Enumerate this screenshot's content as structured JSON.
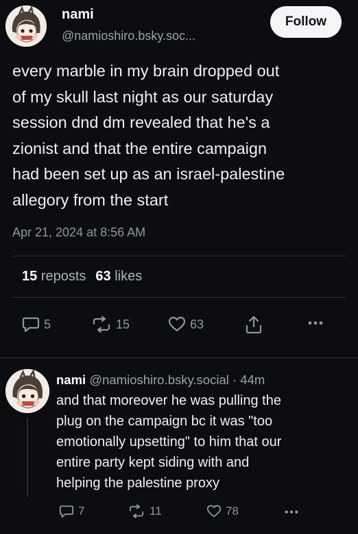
{
  "post": {
    "author": {
      "display_name": "nami",
      "handle": "@namioshiro.bsky.soc..."
    },
    "follow_label": "Follow",
    "text_lines": [
      "every marble in my brain dropped out",
      "of my skull last night as our saturday",
      "session dnd dm revealed that he's a",
      "zionist and that the entire campaign",
      "had been set up as an israel-palestine",
      "allegory from the start"
    ],
    "timestamp": "Apr 21, 2024 at 8:56 AM",
    "stats": {
      "reposts_count": "15",
      "reposts_label": "reposts",
      "likes_count": "63",
      "likes_label": "likes"
    },
    "actions": {
      "replies": "5",
      "reposts": "15",
      "likes": "63",
      "share_icon": "share-icon",
      "more_icon": "more-icon"
    }
  },
  "reply": {
    "display_name": "nami",
    "handle": "@namioshiro.bsky.social",
    "separator": "·",
    "age": "44m",
    "text_lines": [
      "and that moreover he was pulling the",
      "plug on the campaign bc it was \"too",
      "emotionally upsetting\" to him that our",
      "entire party kept siding with and",
      "helping the palestine proxy"
    ],
    "actions": {
      "replies": "7",
      "reposts": "11",
      "likes": "78",
      "more_icon": "more-icon"
    }
  },
  "colors": {
    "background": "#0b0d10",
    "text": "#eef0f3",
    "muted": "#8e97a1",
    "divider": "#2a2f36",
    "follow_bg": "#f4f5f7"
  }
}
